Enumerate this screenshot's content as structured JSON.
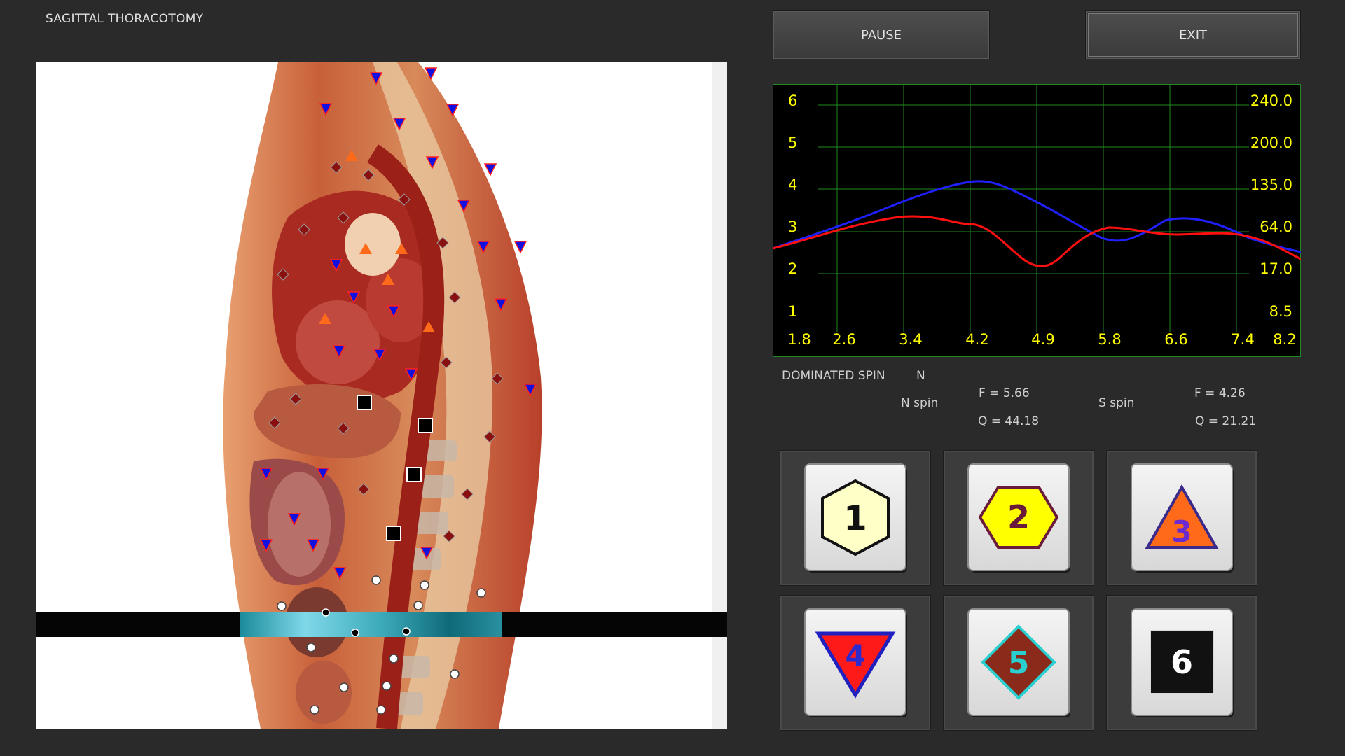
{
  "app": {
    "title": "SAGITTAL THORACOTOMY"
  },
  "controls": {
    "pause_label": "PAUSE",
    "exit_label": "EXIT"
  },
  "graph": {
    "left_ticks": [
      "6",
      "5",
      "4",
      "3",
      "2",
      "1"
    ],
    "right_ticks": [
      "240.0",
      "200.0",
      "135.0",
      "64.0",
      "17.0",
      "8.5"
    ],
    "x_ticks": [
      "1.8",
      "2.6",
      "3.4",
      "4.2",
      "4.9",
      "5.8",
      "6.6",
      "7.4",
      "8.2"
    ],
    "background": "#000000",
    "grid_color": "#1f8a1f",
    "tick_color": "#ffff00",
    "series_colors": [
      "#2020ff",
      "#ff1010"
    ]
  },
  "info": {
    "dominated_label": "DOMINATED SPIN",
    "dominated_value": "N",
    "n_spin": {
      "label": "N spin",
      "f": "F =  5.66",
      "q": "Q = 44.18"
    },
    "s_spin": {
      "label": "S spin",
      "f": "F =  4.26",
      "q": "Q = 21.21"
    }
  },
  "tiles": [
    {
      "number": "1",
      "shape": "hexagon",
      "fill": "#ffffc8"
    },
    {
      "number": "2",
      "shape": "hexagon",
      "fill": "#ffff00"
    },
    {
      "number": "3",
      "shape": "triangle-up",
      "fill": "#ff6a1a"
    },
    {
      "number": "4",
      "shape": "triangle-down",
      "fill": "#ff1a1a"
    },
    {
      "number": "5",
      "shape": "diamond",
      "fill": "#8a2a1a"
    },
    {
      "number": "6",
      "shape": "square",
      "fill": "#111111"
    }
  ]
}
